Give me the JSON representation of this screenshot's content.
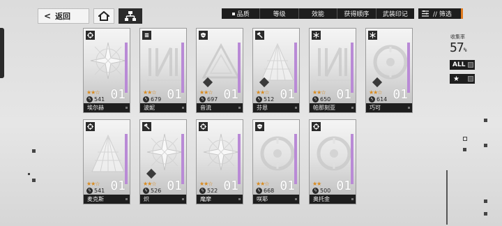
{
  "header": {
    "back_label": "返回",
    "sort_tabs": [
      "品质",
      "等级",
      "效能",
      "获得顺序",
      "武装印记"
    ],
    "filter_label": "// 筛选"
  },
  "side_panel": {
    "collect_label": "收集率",
    "collect_rate": "57",
    "collect_unit": "%",
    "all_label": "ALL",
    "star_label": "★"
  },
  "cards": [
    {
      "name": "埃尔赫",
      "stars": "★★☆",
      "power": "541",
      "num": "01",
      "type": "target-icon",
      "art": "star",
      "gem": false,
      "accent": "#b98ad6"
    },
    {
      "name": "波妮",
      "stars": "★★☆",
      "power": "679",
      "num": "01",
      "type": "fist-icon",
      "art": "lines",
      "gem": false,
      "accent": "#b98ad6"
    },
    {
      "name": "音流",
      "stars": "★★☆",
      "power": "697",
      "num": "01",
      "type": "shield-icon",
      "art": "triangle",
      "gem": true,
      "accent": "#b98ad6"
    },
    {
      "name": "芬恩",
      "stars": "★★☆",
      "power": "512",
      "num": "01",
      "type": "hammer-icon",
      "art": "fan",
      "gem": true,
      "accent": "#b98ad6"
    },
    {
      "name": "帕那刻亚",
      "stars": "★★☆",
      "power": "650",
      "num": "01",
      "type": "snowflake-icon",
      "art": "lines",
      "gem": false,
      "accent": "#b98ad6"
    },
    {
      "name": "巧可",
      "stars": "★★☆",
      "power": "614",
      "num": "01",
      "type": "snowflake-icon",
      "art": "circle",
      "gem": true,
      "accent": "#b98ad6"
    },
    {
      "name": "麦克斯",
      "stars": "★★☆",
      "power": "541",
      "num": "01",
      "type": "target-icon",
      "art": "fan",
      "gem": false,
      "accent": "#b98ad6"
    },
    {
      "name": "炽",
      "stars": "★★☆",
      "power": "526",
      "num": "01",
      "type": "hammer-icon",
      "art": "star",
      "gem": true,
      "accent": "#b98ad6"
    },
    {
      "name": "麾摩",
      "stars": "★★☆",
      "power": "522",
      "num": "01",
      "type": "target-icon",
      "art": "star",
      "gem": false,
      "accent": "#b98ad6"
    },
    {
      "name": "咲耶",
      "stars": "★★☆",
      "power": "668",
      "num": "01",
      "type": "shield-icon",
      "art": "circle",
      "gem": false,
      "accent": "#b98ad6"
    },
    {
      "name": "奥托金",
      "stars": "★★",
      "power": "500",
      "num": "01",
      "type": "target-icon",
      "art": "circle",
      "gem": false,
      "accent": "#b98ad6"
    }
  ]
}
